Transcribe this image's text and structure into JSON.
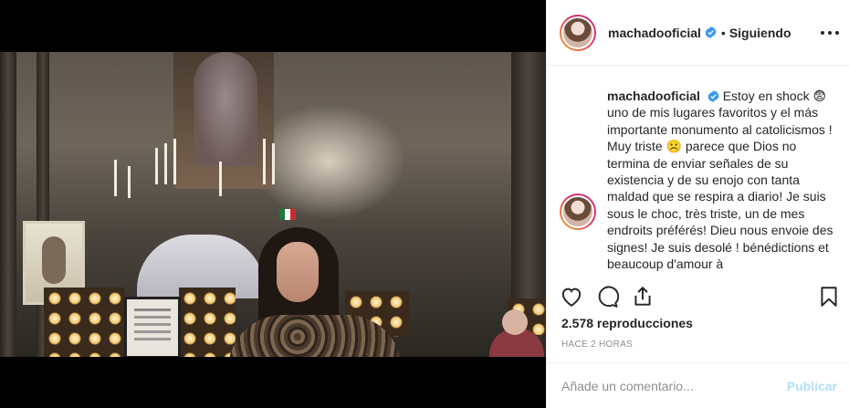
{
  "header": {
    "username": "machadooficial",
    "separator": "•",
    "following_label": "Siguiendo"
  },
  "caption": {
    "username": "machadooficial",
    "text": "Estoy en shock 😨 uno de mis lugares favoritos y el más importante monumento al catolicismos ! Muy triste ☹️ parece que Dios no termina de enviar señales de su existencia y de su enojo con tanta maldad que se respira a diario! Je suis sous le choc, très triste, un de mes endroits préférés! Dieu nous envoie des signes! Je suis desolé ! bénédictions et beaucoup d'amour à"
  },
  "stats": {
    "views": "2.578 reproducciones",
    "timestamp": "HACE 2 HORAS"
  },
  "comment": {
    "placeholder": "Añade un comentario...",
    "publish_label": "Publicar"
  },
  "icons": {
    "like": "heart-icon",
    "comment": "comment-icon",
    "share": "share-icon",
    "save": "bookmark-icon",
    "verified": "verified-badge-icon",
    "more": "more-options-icon"
  },
  "colors": {
    "text": "#262626",
    "muted": "#8e8e8e",
    "verified": "#3897f0",
    "publish_disabled": "#b2dffc",
    "border": "#efefef"
  }
}
